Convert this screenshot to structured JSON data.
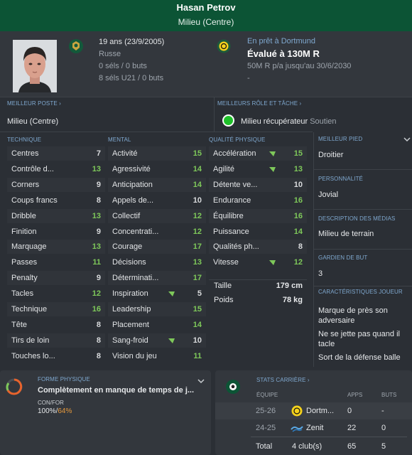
{
  "header": {
    "name": "Hasan Petrov",
    "position": "Milieu (Centre)"
  },
  "profile": {
    "age": "19 ans (23/9/2005)",
    "nationality": "Russe",
    "caps": "0 séls / 0 buts",
    "u21_caps": "8 séls U21 / 0 buts",
    "loan": "En prêt à Dortmund",
    "value": "Évalué à 130M R",
    "contract": "50M R p/a jusqu'au 30/6/2030",
    "dash": "-"
  },
  "best_position": {
    "label": "MEILLEUR POSTE",
    "value": "Milieu (Centre)"
  },
  "best_role": {
    "label": "MEILLEURS RÔLE ET TÂCHE",
    "role": "Milieu récupérateur",
    "duty": "Soutien"
  },
  "technical": {
    "label": "TECHNIQUE",
    "attrs": [
      {
        "name": "Centres",
        "value": "7",
        "color": "w"
      },
      {
        "name": "Contrôle d...",
        "value": "13",
        "color": "g"
      },
      {
        "name": "Corners",
        "value": "9",
        "color": "w"
      },
      {
        "name": "Coups francs",
        "value": "8",
        "color": "w"
      },
      {
        "name": "Dribble",
        "value": "13",
        "color": "g"
      },
      {
        "name": "Finition",
        "value": "9",
        "color": "w"
      },
      {
        "name": "Marquage",
        "value": "13",
        "color": "g"
      },
      {
        "name": "Passes",
        "value": "11",
        "color": "g"
      },
      {
        "name": "Penalty",
        "value": "9",
        "color": "w"
      },
      {
        "name": "Tacles",
        "value": "12",
        "color": "g"
      },
      {
        "name": "Technique",
        "value": "16",
        "color": "g"
      },
      {
        "name": "Tête",
        "value": "8",
        "color": "w"
      },
      {
        "name": "Tirs de loin",
        "value": "8",
        "color": "w"
      },
      {
        "name": "Touches lo...",
        "value": "8",
        "color": "w"
      }
    ]
  },
  "mental": {
    "label": "MENTAL",
    "attrs": [
      {
        "name": "Activité",
        "value": "15",
        "color": "g"
      },
      {
        "name": "Agressivité",
        "value": "14",
        "color": "g"
      },
      {
        "name": "Anticipation",
        "value": "14",
        "color": "g"
      },
      {
        "name": "Appels de...",
        "value": "10",
        "color": "w"
      },
      {
        "name": "Collectif",
        "value": "12",
        "color": "g"
      },
      {
        "name": "Concentrati...",
        "value": "12",
        "color": "g"
      },
      {
        "name": "Courage",
        "value": "17",
        "color": "g"
      },
      {
        "name": "Décisions",
        "value": "13",
        "color": "g"
      },
      {
        "name": "Déterminati...",
        "value": "17",
        "color": "g"
      },
      {
        "name": "Inspiration",
        "value": "5",
        "color": "w",
        "arrow": true
      },
      {
        "name": "Leadership",
        "value": "15",
        "color": "g"
      },
      {
        "name": "Placement",
        "value": "14",
        "color": "g"
      },
      {
        "name": "Sang-froid",
        "value": "10",
        "color": "w",
        "arrow": true
      },
      {
        "name": "Vision du jeu",
        "value": "11",
        "color": "g"
      }
    ]
  },
  "physical": {
    "label": "QUALITÉ PHYSIQUE",
    "attrs": [
      {
        "name": "Accélération",
        "value": "15",
        "color": "g",
        "arrow": true
      },
      {
        "name": "Agilité",
        "value": "13",
        "color": "g",
        "arrow": true
      },
      {
        "name": "Détente ve...",
        "value": "10",
        "color": "w"
      },
      {
        "name": "Endurance",
        "value": "16",
        "color": "g"
      },
      {
        "name": "Équilibre",
        "value": "16",
        "color": "g"
      },
      {
        "name": "Puissance",
        "value": "14",
        "color": "g"
      },
      {
        "name": "Qualités ph...",
        "value": "8",
        "color": "w"
      },
      {
        "name": "Vitesse",
        "value": "12",
        "color": "g",
        "arrow": true
      }
    ],
    "height_label": "Taille",
    "height": "179 cm",
    "weight_label": "Poids",
    "weight": "78 kg"
  },
  "side": {
    "foot_label": "MEILLEUR PIED",
    "foot": "Droitier",
    "personality_label": "PERSONNALITÉ",
    "personality": "Jovial",
    "media_label": "DESCRIPTION DES MÉDIAS",
    "media": "Milieu de terrain",
    "gk_label": "GARDIEN DE BUT",
    "gk": "3",
    "traits_label": "CARACTÉRISTIQUES JOUEUR",
    "trait1": "Marque de près son adversaire",
    "trait2": "Ne se jette pas quand il tacle",
    "trait3": "Sort de la défense balle"
  },
  "fitness": {
    "label": "FORME PHYSIQUE",
    "status": "Complètement en manque de temps de j...",
    "conf_label": "CON/FOR",
    "conf": "100%/",
    "form": "64%"
  },
  "career": {
    "label": "STATS CARRIÈRE",
    "col_team": "ÉQUIPE",
    "col_apps": "APPS",
    "col_goals": "BUTS",
    "rows": [
      {
        "season": "25-26",
        "team": "Dortm...",
        "apps": "0",
        "goals": "-"
      },
      {
        "season": "24-25",
        "team": "Zenit",
        "apps": "22",
        "goals": "0"
      }
    ],
    "total_label": "Total",
    "total_clubs": "4 club(s)",
    "total_apps": "65",
    "total_goals": "5"
  },
  "colors": {
    "header": "#0c5435",
    "green_value": "#7ec85a",
    "accent_label": "#7fa8cf",
    "form_orange": "#e89a3c"
  }
}
